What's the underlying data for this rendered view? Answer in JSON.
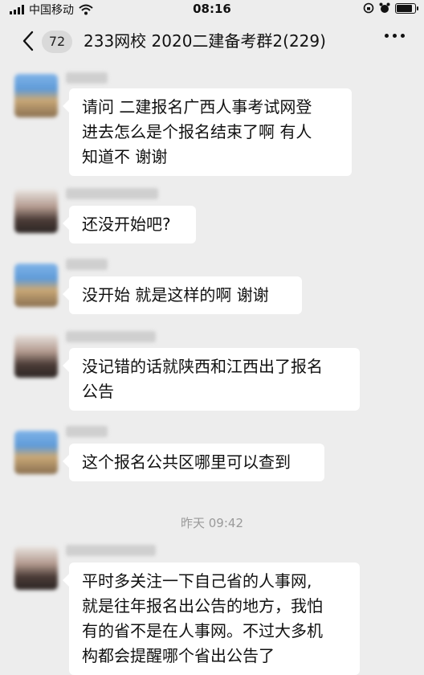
{
  "status_bar": {
    "carrier": "中国移动",
    "time": "08:16"
  },
  "nav": {
    "back_count": "72",
    "title": "233网校 2020二建备考群2(229)"
  },
  "messages": [
    {
      "text": "请问 二建报名广西人事考试网登\n进去怎么是个报名结束了啊  有人\n知道不   谢谢"
    },
    {
      "text": "还没开始吧?"
    },
    {
      "text": "没开始 就是这样的啊  谢谢"
    },
    {
      "text": "没记错的话就陕西和江西出了报名\n公告"
    },
    {
      "text": "这个报名公共区哪里可以查到"
    },
    {
      "text": "平时多关注一下自己省的人事网,\n就是往年报名出公告的地方，我怕\n有的省不是在人事网。不过大多机\n构都会提醒哪个省出公告了"
    }
  ],
  "timestamp": "昨天 09:42",
  "icons": [
    "signal-icon",
    "wifi-icon",
    "lock-rotation-icon",
    "alarm-icon",
    "battery-icon",
    "back-chevron-icon",
    "more-icon"
  ]
}
